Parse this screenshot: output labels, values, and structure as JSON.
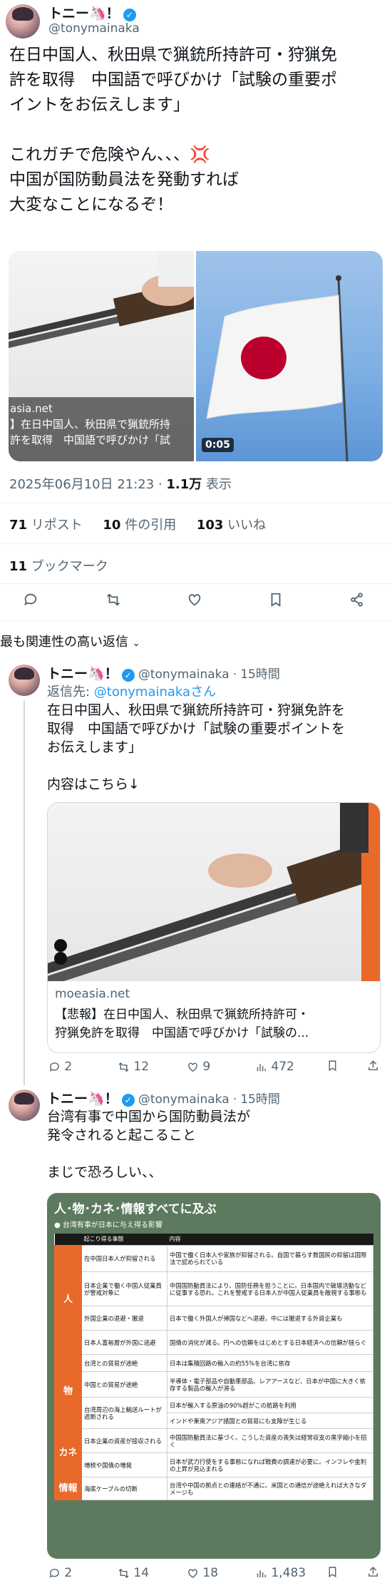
{
  "main_tweet": {
    "author_name": "トニー🦄！",
    "handle": "@tonymainaka",
    "text_lines": [
      "在日中国人、秋田県で猟銃所持許可・狩猟免",
      "許を取得　中国語で呼びかけ「試験の重要ポ",
      "イントをお伝えします」",
      "",
      "これガチで危険やん、、、💢",
      "中国が国防動員法を発動すれば",
      "大変なことになるぞ！"
    ],
    "left_media_caption_lines": [
      "asia.net",
      "】在日中国人、秋田県で猟銃所持",
      "許を取得　中国語で呼びかけ「試"
    ],
    "video_duration": "0:05",
    "timestamp": "2025年06月10日 21:23",
    "views_number": "1.1万",
    "views_label": "表示",
    "reposts_number": "71",
    "reposts_label": "リポスト",
    "quotes_number": "10",
    "quotes_label": "件の引用",
    "likes_number": "103",
    "likes_label": "いいね",
    "bookmarks_number": "11",
    "bookmarks_label": "ブックマーク"
  },
  "sort_label": "最も関連性の高い返信",
  "reply1": {
    "author_name": "トニー🦄！",
    "handle": "@tonymainaka",
    "time": "15時間",
    "reply_to_prefix": "返信先: ",
    "reply_to_handle": "@tonymainakaさん",
    "text_lines": [
      "在日中国人、秋田県で猟銃所持許可・狩猟免許を",
      "取得　中国語で呼びかけ「試験の重要ポイントを",
      "お伝えします」",
      "",
      "内容はこちら↓"
    ],
    "card_domain": "moeasia.net",
    "card_title_lines": [
      "【悲報】在日中国人、秋田県で猟銃所持許可・",
      "狩猟免許を取得　中国語で呼びかけ「試験の..."
    ],
    "replies": "2",
    "reposts": "12",
    "likes": "9",
    "views": "472"
  },
  "reply2": {
    "author_name": "トニー🦄！",
    "handle": "@tonymainaka",
    "time": "15時間",
    "text_lines": [
      "台湾有事で中国から国防動員法が",
      "発令されると起こること",
      "",
      "まじで恐ろしい、、"
    ],
    "infographic": {
      "title": "人･物･カネ･情報すべてに及ぶ",
      "subtitle": "● 台湾有事が日本に与え得る影響",
      "col_headers": [
        "起こり得る事態",
        "内容"
      ],
      "sections": [
        {
          "category": "人",
          "rows": [
            [
              "在中国日本人が抑留される",
              "中国で働く日本人や家族が抑留される。自国で暮らす数国民の抑留は国際法で認められている"
            ],
            [
              "日本企業で働く中国人従業員が警戒対象に",
              "中国国防動員法により、国防任務を担うことに。日本国内で破壊活動などに従事する恐れ。これを警戒する日本人が中国人従業員を敵視する事態も"
            ],
            [
              "外国企業の退避・撤退",
              "日本で働く外国人が帰国などへ退避。中には撤退する外資企業も"
            ],
            [
              "日本人富裕層が外国に逃避",
              "国債の消化が減る。円への信頼をはじめとする日本経済への信頼が揺らぐ"
            ]
          ]
        },
        {
          "category": "物",
          "rows": [
            [
              "台湾との貿易が途絶",
              "日本は集積回路の輸入の約55%を台湾に依存"
            ],
            [
              "中国との貿易が途絶",
              "半導体・電子部品や自動車部品、レアアースなど、日本が中国に大きく依存する製品の輸入が滞る"
            ],
            [
              "台湾周辺の海上輸送ルートが遮断される",
              "日本が輸入する原油の90%超がこの航路を利用"
            ],
            [
              "",
              "インドや東南アジア諸国との貿易にも支障が生じる"
            ]
          ]
        },
        {
          "category": "カネ",
          "rows": [
            [
              "日本企業の資産が接収される",
              "中国国防動員法に基づく。こうした資産の喪失は経常収支の黒字縮小を招く"
            ],
            [
              "増税や国債の増発",
              "日本が武力行使をする事態になれば戦費の調達が必要に。インフレや金利の上昇が見込まれる"
            ]
          ]
        },
        {
          "category": "情報",
          "rows": [
            [
              "海底ケーブルの切断",
              "台湾や中国の拠点との連絡が不通に。米国との通信が途絶えれば大きなダメージも"
            ]
          ]
        }
      ]
    },
    "replies": "2",
    "reposts": "14",
    "likes": "18",
    "views": "1,483"
  },
  "colors": {
    "accent": "#1d9bf0",
    "infographic_bg": "#5d7a5f",
    "category_orange": "#e8692a",
    "flag_red": "#bc002d"
  }
}
